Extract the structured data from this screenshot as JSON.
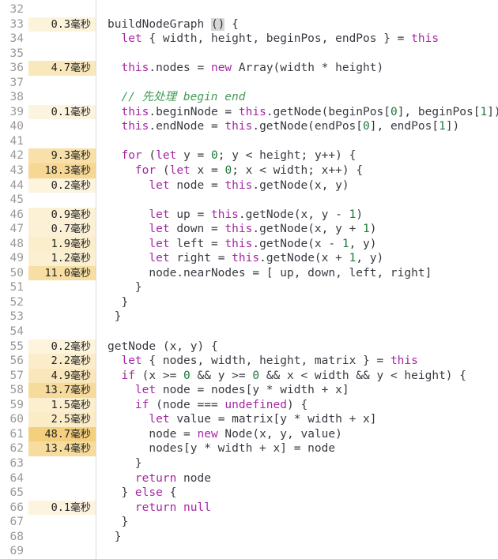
{
  "editor": {
    "title": "code-profiler-view",
    "gutter_label": "line-timings",
    "unit_suffix": "毫秒",
    "colors": {
      "background": "#ffffff",
      "gutter_divider": "#d8d8d8",
      "line_number": "#999999",
      "keyword": "#a626a4",
      "number": "#1d7a3a",
      "comment": "#3f9c52",
      "plain": "#383a42",
      "heat_low": "#fdf6e3",
      "heat_high": "#f5d384",
      "bracket_match": "#d6d6d6"
    },
    "lines": [
      {
        "no": "32",
        "ms": "",
        "heat": 0,
        "code": []
      },
      {
        "no": "33",
        "ms": "0.3",
        "heat": 0.08,
        "code": [
          {
            "t": "plain",
            "v": "buildNodeGraph "
          },
          {
            "t": "sel",
            "v": "()"
          },
          {
            "t": "plain",
            "v": " {"
          }
        ]
      },
      {
        "no": "34",
        "ms": "",
        "heat": 0,
        "code": [
          {
            "t": "plain",
            "v": "  "
          },
          {
            "t": "kw",
            "v": "let"
          },
          {
            "t": "plain",
            "v": " { width, height, beginPos, endPos } = "
          },
          {
            "t": "kw",
            "v": "this"
          }
        ]
      },
      {
        "no": "35",
        "ms": "",
        "heat": 0,
        "code": []
      },
      {
        "no": "36",
        "ms": "4.7",
        "heat": 0.38,
        "code": [
          {
            "t": "plain",
            "v": "  "
          },
          {
            "t": "kw",
            "v": "this"
          },
          {
            "t": "plain",
            "v": ".nodes = "
          },
          {
            "t": "kw",
            "v": "new"
          },
          {
            "t": "plain",
            "v": " Array(width * height)"
          }
        ]
      },
      {
        "no": "37",
        "ms": "",
        "heat": 0,
        "code": []
      },
      {
        "no": "38",
        "ms": "",
        "heat": 0,
        "code": [
          {
            "t": "plain",
            "v": "  "
          },
          {
            "t": "cmt",
            "v": "// 先处理 begin end"
          }
        ]
      },
      {
        "no": "39",
        "ms": "0.1",
        "heat": 0.04,
        "code": [
          {
            "t": "plain",
            "v": "  "
          },
          {
            "t": "kw",
            "v": "this"
          },
          {
            "t": "plain",
            "v": ".beginNode = "
          },
          {
            "t": "kw",
            "v": "this"
          },
          {
            "t": "plain",
            "v": ".getNode(beginPos["
          },
          {
            "t": "num",
            "v": "0"
          },
          {
            "t": "plain",
            "v": "], beginPos["
          },
          {
            "t": "num",
            "v": "1"
          },
          {
            "t": "plain",
            "v": "])"
          }
        ]
      },
      {
        "no": "40",
        "ms": "",
        "heat": 0,
        "code": [
          {
            "t": "plain",
            "v": "  "
          },
          {
            "t": "kw",
            "v": "this"
          },
          {
            "t": "plain",
            "v": ".endNode = "
          },
          {
            "t": "kw",
            "v": "this"
          },
          {
            "t": "plain",
            "v": ".getNode(endPos["
          },
          {
            "t": "num",
            "v": "0"
          },
          {
            "t": "plain",
            "v": "], endPos["
          },
          {
            "t": "num",
            "v": "1"
          },
          {
            "t": "plain",
            "v": "])"
          }
        ]
      },
      {
        "no": "41",
        "ms": "",
        "heat": 0,
        "code": []
      },
      {
        "no": "42",
        "ms": "9.3",
        "heat": 0.58,
        "code": [
          {
            "t": "plain",
            "v": "  "
          },
          {
            "t": "kw",
            "v": "for"
          },
          {
            "t": "plain",
            "v": " ("
          },
          {
            "t": "kw",
            "v": "let"
          },
          {
            "t": "plain",
            "v": " y = "
          },
          {
            "t": "num",
            "v": "0"
          },
          {
            "t": "plain",
            "v": "; y < height; y++) {"
          }
        ]
      },
      {
        "no": "43",
        "ms": "18.3",
        "heat": 0.78,
        "code": [
          {
            "t": "plain",
            "v": "    "
          },
          {
            "t": "kw",
            "v": "for"
          },
          {
            "t": "plain",
            "v": " ("
          },
          {
            "t": "kw",
            "v": "let"
          },
          {
            "t": "plain",
            "v": " x = "
          },
          {
            "t": "num",
            "v": "0"
          },
          {
            "t": "plain",
            "v": "; x < width; x++) {"
          }
        ]
      },
      {
        "no": "44",
        "ms": "0.2",
        "heat": 0.06,
        "code": [
          {
            "t": "plain",
            "v": "      "
          },
          {
            "t": "kw",
            "v": "let"
          },
          {
            "t": "plain",
            "v": " node = "
          },
          {
            "t": "kw",
            "v": "this"
          },
          {
            "t": "plain",
            "v": ".getNode(x, y)"
          }
        ]
      },
      {
        "no": "45",
        "ms": "",
        "heat": 0,
        "code": []
      },
      {
        "no": "46",
        "ms": "0.9",
        "heat": 0.14,
        "code": [
          {
            "t": "plain",
            "v": "      "
          },
          {
            "t": "kw",
            "v": "let"
          },
          {
            "t": "plain",
            "v": " up = "
          },
          {
            "t": "kw",
            "v": "this"
          },
          {
            "t": "plain",
            "v": ".getNode(x, y - "
          },
          {
            "t": "num",
            "v": "1"
          },
          {
            "t": "plain",
            "v": ")"
          }
        ]
      },
      {
        "no": "47",
        "ms": "0.7",
        "heat": 0.12,
        "code": [
          {
            "t": "plain",
            "v": "      "
          },
          {
            "t": "kw",
            "v": "let"
          },
          {
            "t": "plain",
            "v": " down = "
          },
          {
            "t": "kw",
            "v": "this"
          },
          {
            "t": "plain",
            "v": ".getNode(x, y + "
          },
          {
            "t": "num",
            "v": "1"
          },
          {
            "t": "plain",
            "v": ")"
          }
        ]
      },
      {
        "no": "48",
        "ms": "1.9",
        "heat": 0.22,
        "code": [
          {
            "t": "plain",
            "v": "      "
          },
          {
            "t": "kw",
            "v": "let"
          },
          {
            "t": "plain",
            "v": " left = "
          },
          {
            "t": "kw",
            "v": "this"
          },
          {
            "t": "plain",
            "v": ".getNode(x - "
          },
          {
            "t": "num",
            "v": "1"
          },
          {
            "t": "plain",
            "v": ", y)"
          }
        ]
      },
      {
        "no": "49",
        "ms": "1.2",
        "heat": 0.17,
        "code": [
          {
            "t": "plain",
            "v": "      "
          },
          {
            "t": "kw",
            "v": "let"
          },
          {
            "t": "plain",
            "v": " right = "
          },
          {
            "t": "kw",
            "v": "this"
          },
          {
            "t": "plain",
            "v": ".getNode(x + "
          },
          {
            "t": "num",
            "v": "1"
          },
          {
            "t": "plain",
            "v": ", y)"
          }
        ]
      },
      {
        "no": "50",
        "ms": "11.0",
        "heat": 0.64,
        "code": [
          {
            "t": "plain",
            "v": "      node.nearNodes = [ up, down, left, right]"
          }
        ]
      },
      {
        "no": "51",
        "ms": "",
        "heat": 0,
        "code": [
          {
            "t": "plain",
            "v": "    }"
          }
        ]
      },
      {
        "no": "52",
        "ms": "",
        "heat": 0,
        "code": [
          {
            "t": "plain",
            "v": "  }"
          }
        ]
      },
      {
        "no": "53",
        "ms": "",
        "heat": 0,
        "code": [
          {
            "t": "plain",
            "v": " }"
          }
        ]
      },
      {
        "no": "54",
        "ms": "",
        "heat": 0,
        "code": []
      },
      {
        "no": "55",
        "ms": "0.2",
        "heat": 0.06,
        "code": [
          {
            "t": "plain",
            "v": "getNode (x, y) {"
          }
        ]
      },
      {
        "no": "56",
        "ms": "2.2",
        "heat": 0.25,
        "code": [
          {
            "t": "plain",
            "v": "  "
          },
          {
            "t": "kw",
            "v": "let"
          },
          {
            "t": "plain",
            "v": " { nodes, width, height, matrix } = "
          },
          {
            "t": "kw",
            "v": "this"
          }
        ]
      },
      {
        "no": "57",
        "ms": "4.9",
        "heat": 0.4,
        "code": [
          {
            "t": "plain",
            "v": "  "
          },
          {
            "t": "kw",
            "v": "if"
          },
          {
            "t": "plain",
            "v": " (x >= "
          },
          {
            "t": "num",
            "v": "0"
          },
          {
            "t": "plain",
            "v": " && y >= "
          },
          {
            "t": "num",
            "v": "0"
          },
          {
            "t": "plain",
            "v": " && x < width && y < height) {"
          }
        ]
      },
      {
        "no": "58",
        "ms": "13.7",
        "heat": 0.7,
        "code": [
          {
            "t": "plain",
            "v": "    "
          },
          {
            "t": "kw",
            "v": "let"
          },
          {
            "t": "plain",
            "v": " node = nodes[y * width + x]"
          }
        ]
      },
      {
        "no": "59",
        "ms": "1.5",
        "heat": 0.19,
        "code": [
          {
            "t": "plain",
            "v": "    "
          },
          {
            "t": "kw",
            "v": "if"
          },
          {
            "t": "plain",
            "v": " (node === "
          },
          {
            "t": "kw",
            "v": "undefined"
          },
          {
            "t": "plain",
            "v": ") {"
          }
        ]
      },
      {
        "no": "60",
        "ms": "2.5",
        "heat": 0.27,
        "code": [
          {
            "t": "plain",
            "v": "      "
          },
          {
            "t": "kw",
            "v": "let"
          },
          {
            "t": "plain",
            "v": " value = matrix[y * width + x]"
          }
        ]
      },
      {
        "no": "61",
        "ms": "48.7",
        "heat": 1.0,
        "code": [
          {
            "t": "plain",
            "v": "      node = "
          },
          {
            "t": "kw",
            "v": "new"
          },
          {
            "t": "plain",
            "v": " Node(x, y, value)"
          }
        ]
      },
      {
        "no": "62",
        "ms": "13.4",
        "heat": 0.69,
        "code": [
          {
            "t": "plain",
            "v": "      nodes[y * width + x] = node"
          }
        ]
      },
      {
        "no": "63",
        "ms": "",
        "heat": 0,
        "code": [
          {
            "t": "plain",
            "v": "    }"
          }
        ]
      },
      {
        "no": "64",
        "ms": "",
        "heat": 0,
        "code": [
          {
            "t": "plain",
            "v": "    "
          },
          {
            "t": "kw",
            "v": "return"
          },
          {
            "t": "plain",
            "v": " node"
          }
        ]
      },
      {
        "no": "65",
        "ms": "",
        "heat": 0,
        "code": [
          {
            "t": "plain",
            "v": "  } "
          },
          {
            "t": "kw",
            "v": "else"
          },
          {
            "t": "plain",
            "v": " {"
          }
        ]
      },
      {
        "no": "66",
        "ms": "0.1",
        "heat": 0.04,
        "code": [
          {
            "t": "plain",
            "v": "    "
          },
          {
            "t": "kw",
            "v": "return"
          },
          {
            "t": "plain",
            "v": " "
          },
          {
            "t": "kw",
            "v": "null"
          }
        ]
      },
      {
        "no": "67",
        "ms": "",
        "heat": 0,
        "code": [
          {
            "t": "plain",
            "v": "  }"
          }
        ]
      },
      {
        "no": "68",
        "ms": "",
        "heat": 0,
        "code": [
          {
            "t": "plain",
            "v": " }"
          }
        ]
      },
      {
        "no": "69",
        "ms": "",
        "heat": 0,
        "code": []
      }
    ]
  }
}
